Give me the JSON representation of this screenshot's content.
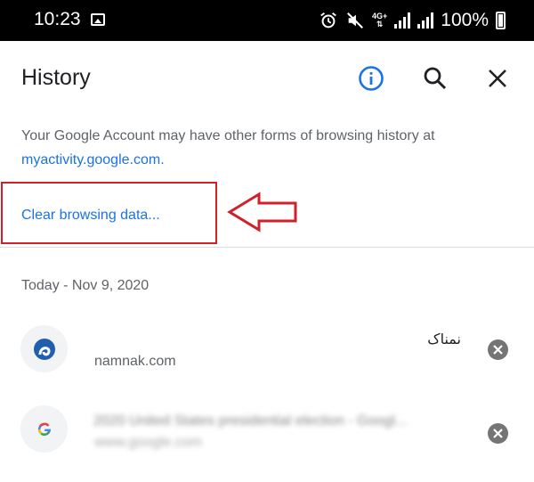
{
  "status_bar": {
    "time": "10:23",
    "network": "4G+",
    "battery_percent": "100%",
    "icons": [
      "image-icon",
      "alarm-icon",
      "mute-icon",
      "signal-icon",
      "battery-icon"
    ]
  },
  "header": {
    "title": "History",
    "actions": [
      "info-icon",
      "search-icon",
      "close-icon"
    ]
  },
  "notice": {
    "text": "Your Google Account may have other forms of browsing history at",
    "link": "myactivity.google.com."
  },
  "clear_browsing_label": "Clear browsing data...",
  "annotation": {
    "color": "#d0202a"
  },
  "section": {
    "date_header": "Today - Nov 9, 2020"
  },
  "history_items": [
    {
      "title": "نمناک",
      "url": "namnak.com",
      "icon": "namnak-favicon"
    },
    {
      "title": "2020 United States presidential election - Googl...",
      "url": "www.google.com",
      "icon": "google-favicon",
      "blurred": true
    }
  ],
  "colors": {
    "accent": "#1a73e8",
    "text": "#202124",
    "secondary": "#5f6368"
  }
}
